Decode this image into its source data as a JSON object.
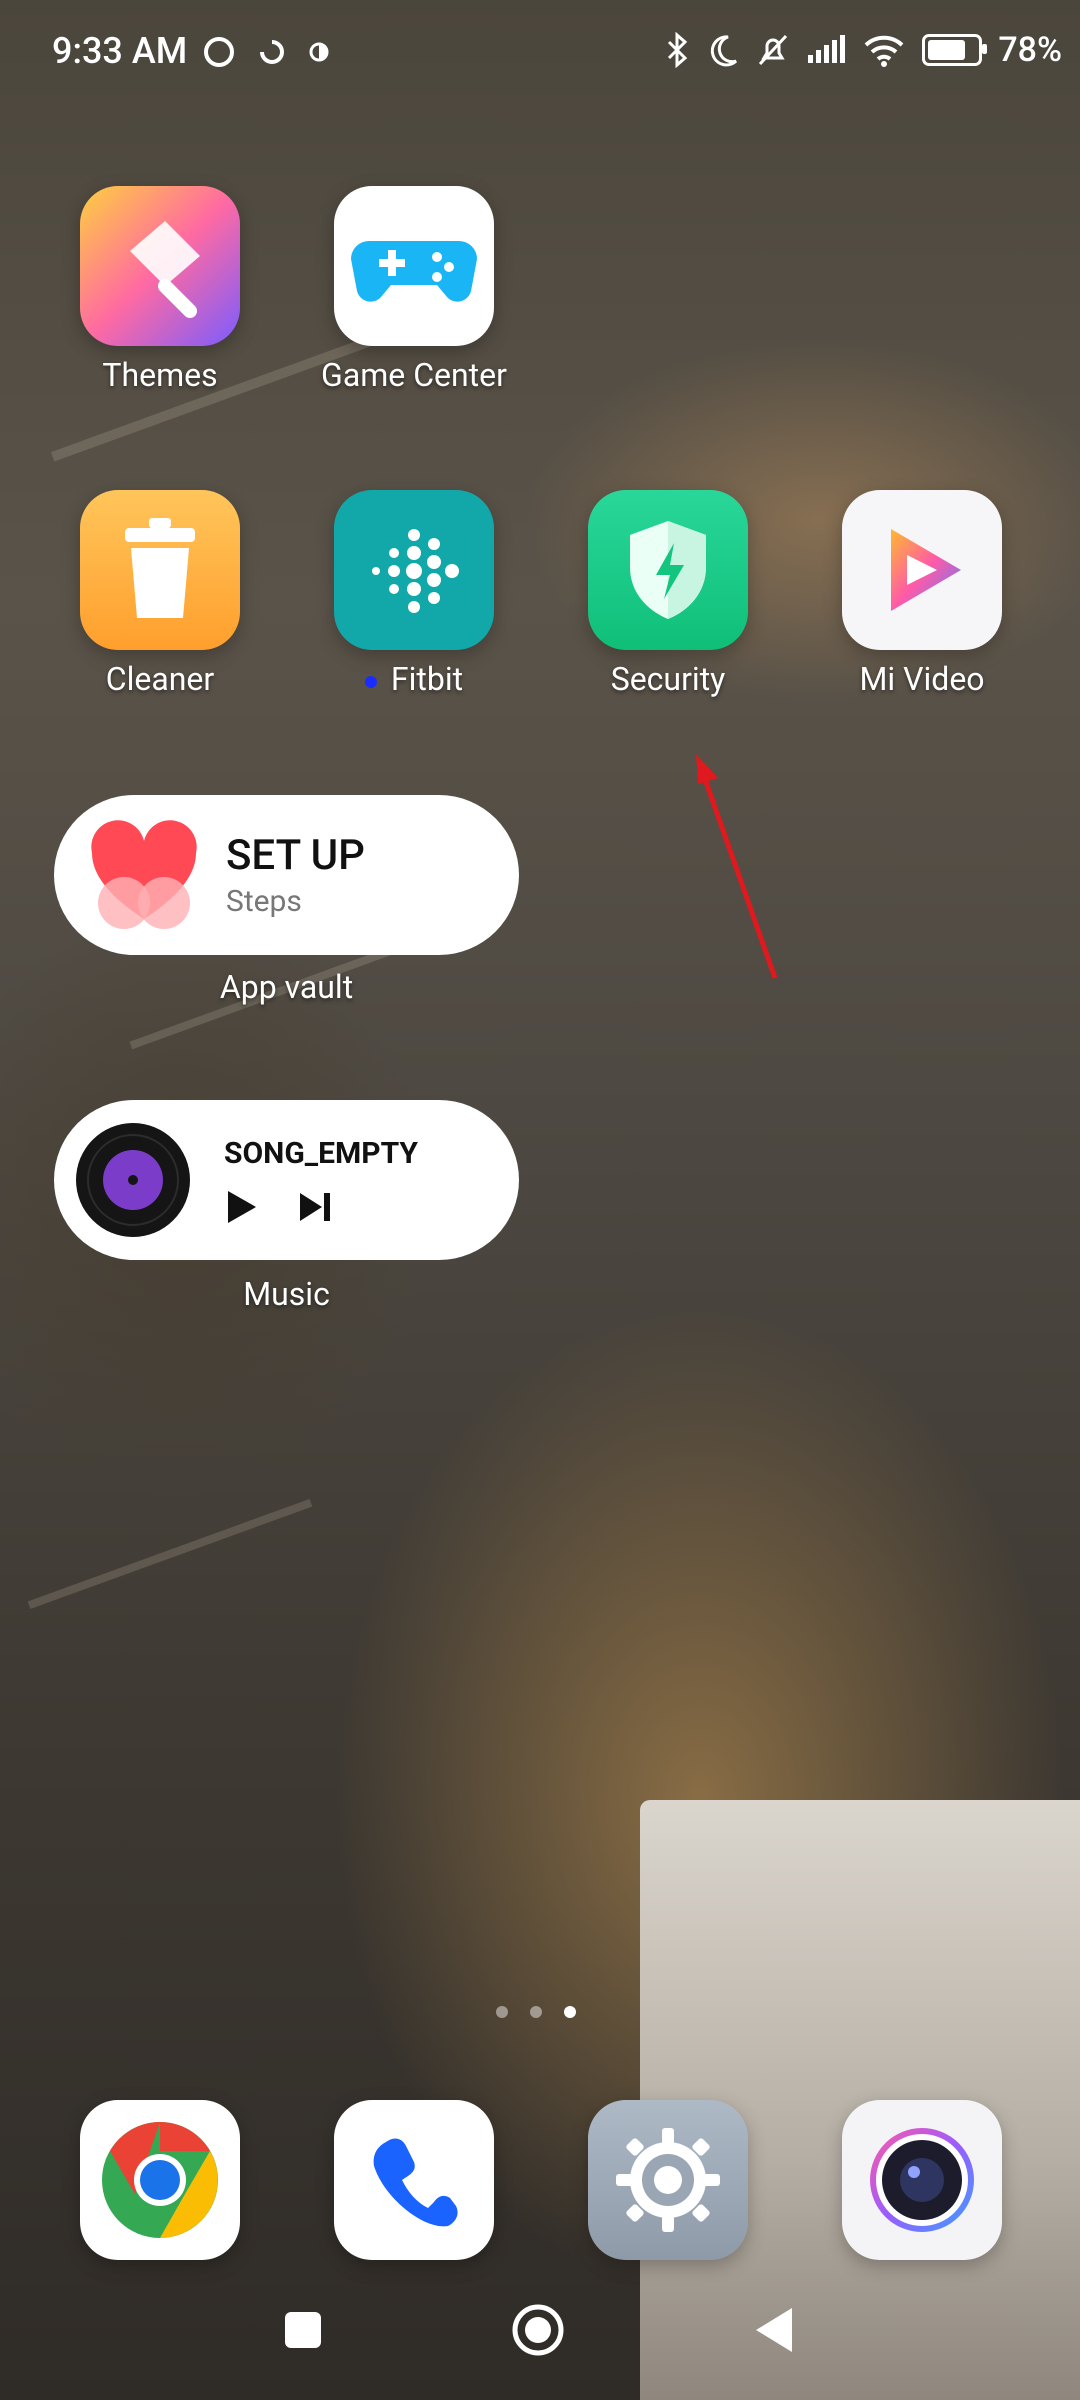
{
  "status": {
    "time": "9:33 AM",
    "battery_percent": 78,
    "battery_text": "78%"
  },
  "apps": {
    "row1": [
      {
        "label": "Themes",
        "icon": "themes-icon"
      },
      {
        "label": "Game Center",
        "icon": "game-center-icon"
      }
    ],
    "row2": [
      {
        "label": "Cleaner",
        "icon": "cleaner-icon"
      },
      {
        "label": "Fitbit",
        "icon": "fitbit-icon"
      },
      {
        "label": "Security",
        "icon": "security-icon"
      },
      {
        "label": "Mi Video",
        "icon": "mi-video-icon"
      }
    ]
  },
  "widgets": {
    "app_vault": {
      "title": "SET UP",
      "subtitle": "Steps",
      "label": "App vault"
    },
    "music": {
      "title": "SONG_EMPTY",
      "label": "Music"
    }
  },
  "page_indicator": {
    "count": 3,
    "active": 3
  },
  "dock": [
    {
      "icon": "chrome-icon"
    },
    {
      "icon": "phone-icon"
    },
    {
      "icon": "settings-icon"
    },
    {
      "icon": "camera-icon"
    }
  ],
  "colors": {
    "security_green": "#1fcf8a",
    "fitbit_teal": "#12a7a8",
    "cleaner_orange": "#ffb13b",
    "arrow_red": "#e0191e"
  }
}
